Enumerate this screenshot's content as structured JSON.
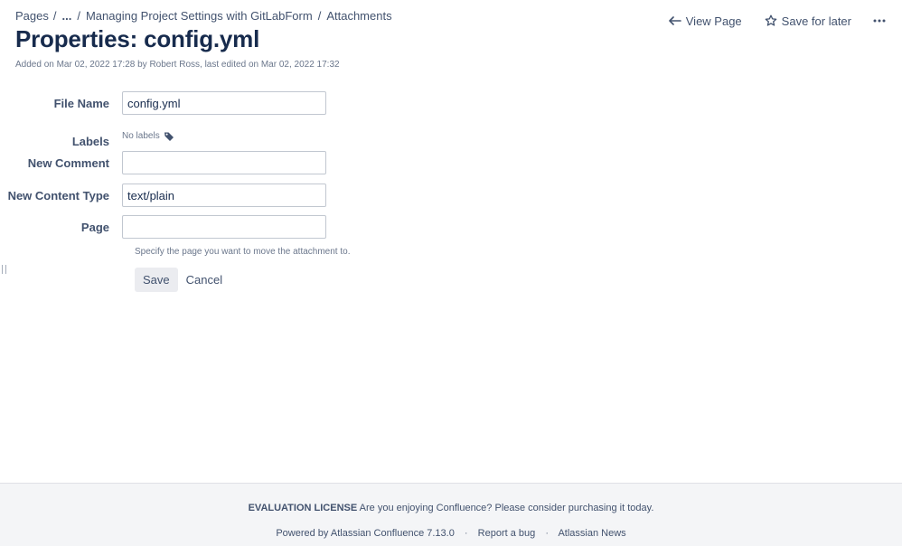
{
  "breadcrumb": {
    "pages": "Pages",
    "ellipsis": "...",
    "parent": "Managing Project Settings with GitLabForm",
    "current": "Attachments",
    "separator": "/"
  },
  "actions": {
    "view_page": "View Page",
    "save_for_later": "Save for later"
  },
  "title": "Properties: config.yml",
  "meta": "Added on Mar 02, 2022 17:28 by Robert Ross, last edited on Mar 02, 2022 17:32",
  "form": {
    "file_name": {
      "label": "File Name",
      "value": "config.yml"
    },
    "labels": {
      "label": "Labels",
      "value": "No labels"
    },
    "new_comment": {
      "label": "New Comment",
      "value": ""
    },
    "new_content_type": {
      "label": "New Content Type",
      "value": "text/plain"
    },
    "page": {
      "label": "Page",
      "value": ""
    },
    "page_hint": "Specify the page you want to move the attachment to.",
    "save": "Save",
    "cancel": "Cancel"
  },
  "footer": {
    "license_strong": "EVALUATION LICENSE",
    "license_text": "Are you enjoying Confluence? Please consider purchasing it today.",
    "powered_by": "Powered by Atlassian Confluence 7.13.0",
    "report_bug": "Report a bug",
    "news": "Atlassian News",
    "dot": "·"
  },
  "icons": {
    "view_page": "arrow-back-icon",
    "save_for_later": "star-outline-icon",
    "more": "more-horizontal-icon",
    "label": "tag-icon"
  }
}
